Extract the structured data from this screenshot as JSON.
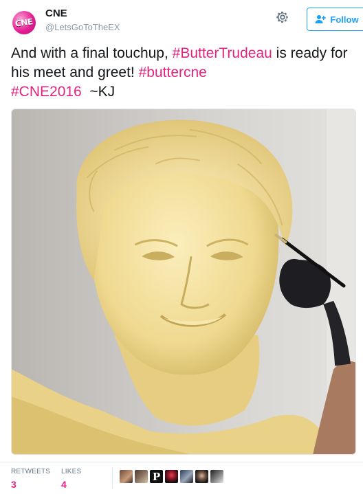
{
  "tweet": {
    "author": {
      "name": "CNE",
      "handle": "@LetsGoToTheEX",
      "avatar_text": "CNE"
    },
    "follow_label": "Follow",
    "text_segments": [
      {
        "text": "And with a final touchup, ",
        "type": "text"
      },
      {
        "text": "#ButterTrudeau",
        "type": "hashtag"
      },
      {
        "text": " is ready for his meet and greet! ",
        "type": "text"
      },
      {
        "text": "#buttercne",
        "type": "hashtag"
      },
      {
        "text": " ",
        "type": "text"
      },
      {
        "text": "#CNE2016",
        "type": "hashtag"
      },
      {
        "text": "  ~KJ",
        "type": "text"
      }
    ],
    "stats": {
      "retweets_label": "RETWEETS",
      "retweets": "3",
      "likes_label": "LIKES",
      "likes": "4"
    },
    "liker_avatars": [
      "liker-1",
      "liker-2",
      "liker-3",
      "liker-4",
      "liker-5",
      "liker-6",
      "liker-7"
    ],
    "liker_p_letter": "P"
  },
  "colors": {
    "hashtag": "#e0247f",
    "follow_blue": "#1da1f2",
    "muted": "#657786",
    "butter": "#f1de9b"
  },
  "icons": {
    "settings": "gear-icon",
    "follow": "add-user-icon"
  }
}
